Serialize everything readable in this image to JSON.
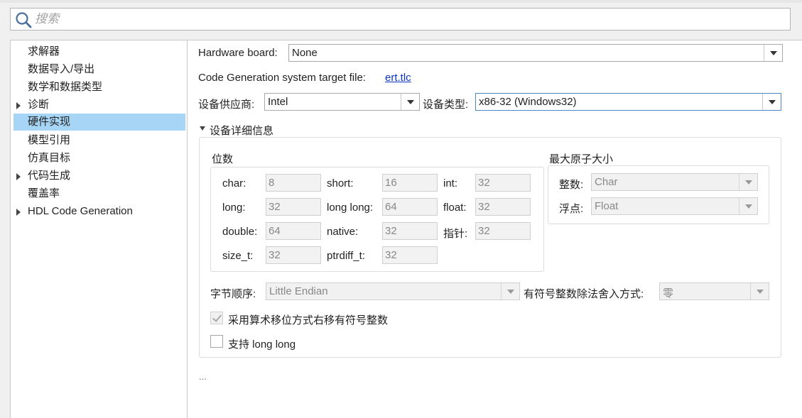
{
  "search": {
    "placeholder": "搜索"
  },
  "tree": {
    "items": [
      {
        "label": "求解器",
        "expandable": false,
        "selected": false
      },
      {
        "label": "数据导入/导出",
        "expandable": false,
        "selected": false
      },
      {
        "label": "数学和数据类型",
        "expandable": false,
        "selected": false
      },
      {
        "label": "诊断",
        "expandable": true,
        "selected": false
      },
      {
        "label": "硬件实现",
        "expandable": false,
        "selected": true
      },
      {
        "label": "模型引用",
        "expandable": false,
        "selected": false
      },
      {
        "label": "仿真目标",
        "expandable": false,
        "selected": false
      },
      {
        "label": "代码生成",
        "expandable": true,
        "selected": false
      },
      {
        "label": "覆盖率",
        "expandable": false,
        "selected": false
      },
      {
        "label": "HDL Code Generation",
        "expandable": true,
        "selected": false
      }
    ]
  },
  "hardware": {
    "board_label": "Hardware board:",
    "board_value": "None",
    "target_file_label": "Code Generation system target file:",
    "target_file_link": "ert.tlc",
    "vendor_label": "设备供应商:",
    "vendor_value": "Intel",
    "type_label": "设备类型:",
    "type_value": "x86-32 (Windows32)"
  },
  "details": {
    "section_label": "设备详细信息",
    "bits": {
      "title": "位数",
      "fields": [
        {
          "label": "char:",
          "value": "8"
        },
        {
          "label": "short:",
          "value": "16"
        },
        {
          "label": "int:",
          "value": "32"
        },
        {
          "label": "long:",
          "value": "32"
        },
        {
          "label": "long long:",
          "value": "64"
        },
        {
          "label": "float:",
          "value": "32"
        },
        {
          "label": "double:",
          "value": "64"
        },
        {
          "label": "native:",
          "value": "32"
        },
        {
          "label": "指针:",
          "value": "32"
        },
        {
          "label": "size_t:",
          "value": "32"
        },
        {
          "label": "ptrdiff_t:",
          "value": "32"
        }
      ]
    },
    "atomic": {
      "title": "最大原子大小",
      "integer_label": "整数:",
      "integer_value": "Char",
      "float_label": "浮点:",
      "float_value": "Float"
    },
    "byte_order_label": "字节顺序:",
    "byte_order_value": "Little Endian",
    "rounding_label": "有符号整数除法舍入方式:",
    "rounding_value": "零",
    "shift_checkbox_label": "采用算术移位方式右移有符号整数",
    "shift_checked": true,
    "longlong_checkbox_label": "支持 long long",
    "longlong_checked": false
  },
  "ellipsis": "..."
}
